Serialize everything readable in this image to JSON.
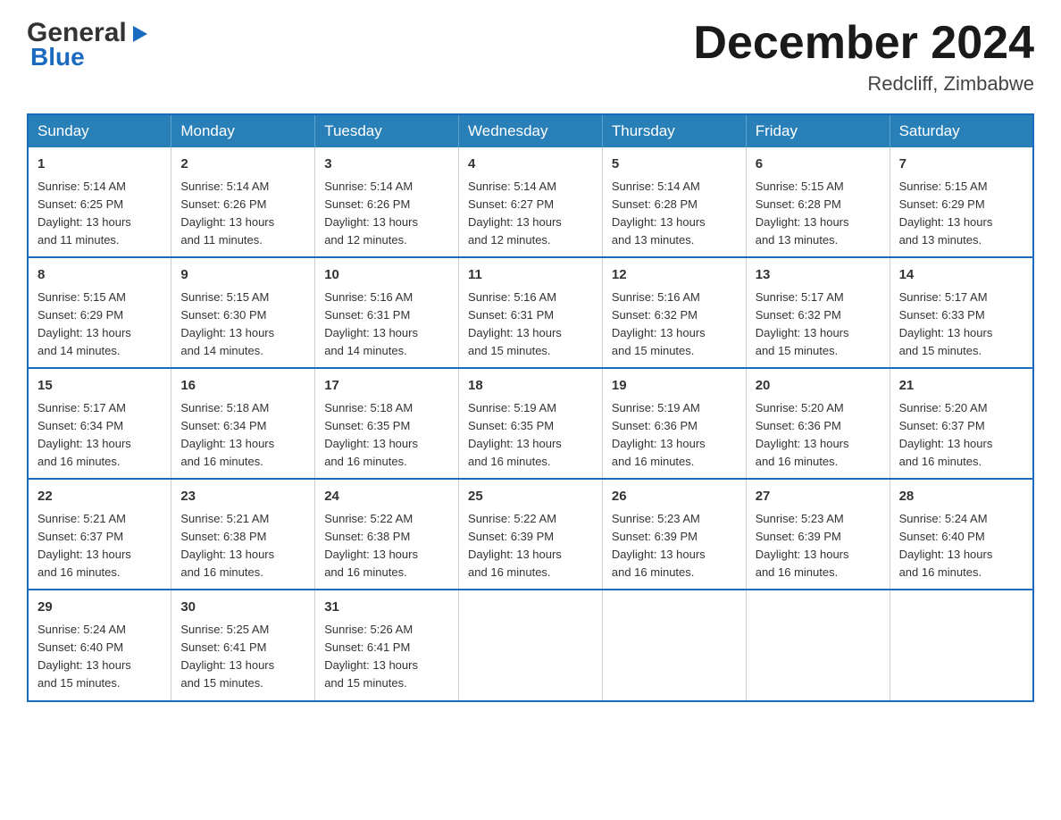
{
  "logo": {
    "general": "General",
    "blue": "Blue",
    "triangle": "▶"
  },
  "header": {
    "title": "December 2024",
    "subtitle": "Redcliff, Zimbabwe"
  },
  "calendar": {
    "days_of_week": [
      "Sunday",
      "Monday",
      "Tuesday",
      "Wednesday",
      "Thursday",
      "Friday",
      "Saturday"
    ],
    "weeks": [
      [
        {
          "num": "1",
          "sunrise": "5:14 AM",
          "sunset": "6:25 PM",
          "daylight_hours": "13",
          "daylight_minutes": "11"
        },
        {
          "num": "2",
          "sunrise": "5:14 AM",
          "sunset": "6:26 PM",
          "daylight_hours": "13",
          "daylight_minutes": "11"
        },
        {
          "num": "3",
          "sunrise": "5:14 AM",
          "sunset": "6:26 PM",
          "daylight_hours": "13",
          "daylight_minutes": "12"
        },
        {
          "num": "4",
          "sunrise": "5:14 AM",
          "sunset": "6:27 PM",
          "daylight_hours": "13",
          "daylight_minutes": "12"
        },
        {
          "num": "5",
          "sunrise": "5:14 AM",
          "sunset": "6:28 PM",
          "daylight_hours": "13",
          "daylight_minutes": "13"
        },
        {
          "num": "6",
          "sunrise": "5:15 AM",
          "sunset": "6:28 PM",
          "daylight_hours": "13",
          "daylight_minutes": "13"
        },
        {
          "num": "7",
          "sunrise": "5:15 AM",
          "sunset": "6:29 PM",
          "daylight_hours": "13",
          "daylight_minutes": "13"
        }
      ],
      [
        {
          "num": "8",
          "sunrise": "5:15 AM",
          "sunset": "6:29 PM",
          "daylight_hours": "13",
          "daylight_minutes": "14"
        },
        {
          "num": "9",
          "sunrise": "5:15 AM",
          "sunset": "6:30 PM",
          "daylight_hours": "13",
          "daylight_minutes": "14"
        },
        {
          "num": "10",
          "sunrise": "5:16 AM",
          "sunset": "6:31 PM",
          "daylight_hours": "13",
          "daylight_minutes": "14"
        },
        {
          "num": "11",
          "sunrise": "5:16 AM",
          "sunset": "6:31 PM",
          "daylight_hours": "13",
          "daylight_minutes": "15"
        },
        {
          "num": "12",
          "sunrise": "5:16 AM",
          "sunset": "6:32 PM",
          "daylight_hours": "13",
          "daylight_minutes": "15"
        },
        {
          "num": "13",
          "sunrise": "5:17 AM",
          "sunset": "6:32 PM",
          "daylight_hours": "13",
          "daylight_minutes": "15"
        },
        {
          "num": "14",
          "sunrise": "5:17 AM",
          "sunset": "6:33 PM",
          "daylight_hours": "13",
          "daylight_minutes": "15"
        }
      ],
      [
        {
          "num": "15",
          "sunrise": "5:17 AM",
          "sunset": "6:34 PM",
          "daylight_hours": "13",
          "daylight_minutes": "16"
        },
        {
          "num": "16",
          "sunrise": "5:18 AM",
          "sunset": "6:34 PM",
          "daylight_hours": "13",
          "daylight_minutes": "16"
        },
        {
          "num": "17",
          "sunrise": "5:18 AM",
          "sunset": "6:35 PM",
          "daylight_hours": "13",
          "daylight_minutes": "16"
        },
        {
          "num": "18",
          "sunrise": "5:19 AM",
          "sunset": "6:35 PM",
          "daylight_hours": "13",
          "daylight_minutes": "16"
        },
        {
          "num": "19",
          "sunrise": "5:19 AM",
          "sunset": "6:36 PM",
          "daylight_hours": "13",
          "daylight_minutes": "16"
        },
        {
          "num": "20",
          "sunrise": "5:20 AM",
          "sunset": "6:36 PM",
          "daylight_hours": "13",
          "daylight_minutes": "16"
        },
        {
          "num": "21",
          "sunrise": "5:20 AM",
          "sunset": "6:37 PM",
          "daylight_hours": "13",
          "daylight_minutes": "16"
        }
      ],
      [
        {
          "num": "22",
          "sunrise": "5:21 AM",
          "sunset": "6:37 PM",
          "daylight_hours": "13",
          "daylight_minutes": "16"
        },
        {
          "num": "23",
          "sunrise": "5:21 AM",
          "sunset": "6:38 PM",
          "daylight_hours": "13",
          "daylight_minutes": "16"
        },
        {
          "num": "24",
          "sunrise": "5:22 AM",
          "sunset": "6:38 PM",
          "daylight_hours": "13",
          "daylight_minutes": "16"
        },
        {
          "num": "25",
          "sunrise": "5:22 AM",
          "sunset": "6:39 PM",
          "daylight_hours": "13",
          "daylight_minutes": "16"
        },
        {
          "num": "26",
          "sunrise": "5:23 AM",
          "sunset": "6:39 PM",
          "daylight_hours": "13",
          "daylight_minutes": "16"
        },
        {
          "num": "27",
          "sunrise": "5:23 AM",
          "sunset": "6:39 PM",
          "daylight_hours": "13",
          "daylight_minutes": "16"
        },
        {
          "num": "28",
          "sunrise": "5:24 AM",
          "sunset": "6:40 PM",
          "daylight_hours": "13",
          "daylight_minutes": "16"
        }
      ],
      [
        {
          "num": "29",
          "sunrise": "5:24 AM",
          "sunset": "6:40 PM",
          "daylight_hours": "13",
          "daylight_minutes": "15"
        },
        {
          "num": "30",
          "sunrise": "5:25 AM",
          "sunset": "6:41 PM",
          "daylight_hours": "13",
          "daylight_minutes": "15"
        },
        {
          "num": "31",
          "sunrise": "5:26 AM",
          "sunset": "6:41 PM",
          "daylight_hours": "13",
          "daylight_minutes": "15"
        },
        null,
        null,
        null,
        null
      ]
    ]
  }
}
